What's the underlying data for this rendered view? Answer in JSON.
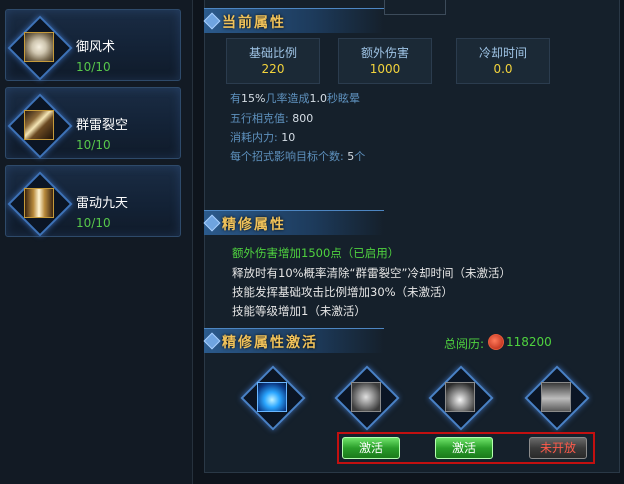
{
  "skills": [
    {
      "name": "御风术",
      "level": "10/10",
      "icon": "wind-swirl-icon"
    },
    {
      "name": "群雷裂空",
      "level": "10/10",
      "icon": "thunder-claw-icon"
    },
    {
      "name": "雷动九天",
      "level": "10/10",
      "icon": "thunder-pillar-icon"
    }
  ],
  "current": {
    "title": "当前属性",
    "stats": [
      {
        "label": "基础比例",
        "value": "220"
      },
      {
        "label": "额外伤害",
        "value": "1000"
      },
      {
        "label": "冷却时间",
        "value": "0.0"
      }
    ],
    "lines": [
      {
        "pre": "有",
        "num": "15%",
        "post": "几率造成",
        "num2": "1.0",
        "post2": "秒眩晕"
      },
      {
        "pre": "五行相克值: ",
        "num": "800",
        "post": "",
        "num2": "",
        "post2": ""
      },
      {
        "pre": "消耗内力: ",
        "num": "10",
        "post": "",
        "num2": "",
        "post2": ""
      },
      {
        "pre": "每个招式影响目标个数: ",
        "num": "5",
        "post": "个",
        "num2": "",
        "post2": ""
      }
    ]
  },
  "refine": {
    "title": "精修属性",
    "lines": [
      {
        "text": "额外伤害增加1500点（已启用）",
        "active": true
      },
      {
        "text": "释放时有10%概率清除“群雷裂空”冷却时间（未激活）",
        "active": false
      },
      {
        "text": "技能发挥基础攻击比例增加30%（未激活）",
        "active": false
      },
      {
        "text": "技能等级增加1（未激活）",
        "active": false
      }
    ]
  },
  "activation": {
    "title": "精修属性激活",
    "total_label": "总阅历:",
    "total_value": "118200",
    "total_icon": "experience-orb-icon",
    "slots": [
      "blue-vortex-icon",
      "gray-flower-icon",
      "gray-flame-icon",
      "gray-mountain-icon"
    ],
    "buttons": [
      {
        "label": "激活",
        "state": "enabled"
      },
      {
        "label": "激活",
        "state": "enabled"
      },
      {
        "label": "未开放",
        "state": "disabled"
      }
    ]
  },
  "colors": {
    "accent_gold": "#f0c25a",
    "value_yellow": "#f2d33c",
    "active_green": "#4fd23f",
    "highlight_red": "#c21010"
  }
}
